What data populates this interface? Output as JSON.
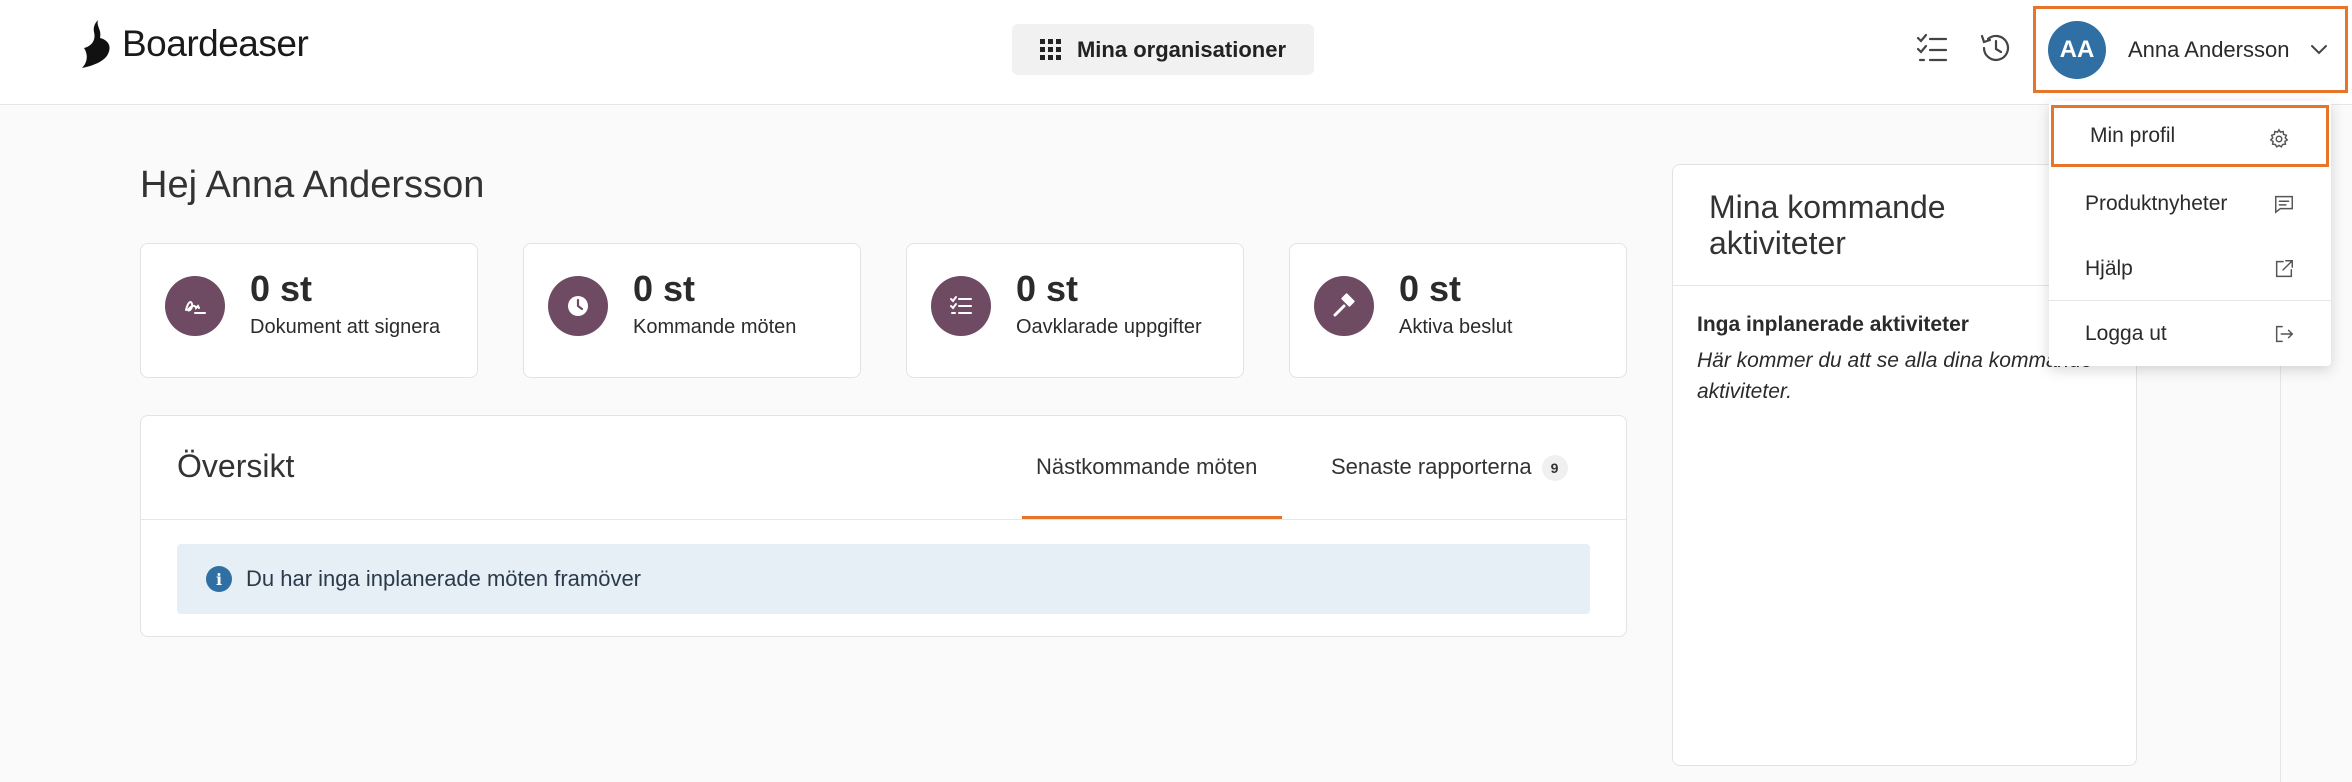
{
  "header": {
    "logo_text": "Boardeaser",
    "org_button_label": "Mina organisationer",
    "user": {
      "initials": "AA",
      "name": "Anna Andersson"
    }
  },
  "greeting": "Hej Anna Andersson",
  "stats": [
    {
      "value": "0 st",
      "label": "Dokument att signera",
      "icon": "signature-icon"
    },
    {
      "value": "0 st",
      "label": "Kommande möten",
      "icon": "clock-icon"
    },
    {
      "value": "0 st",
      "label": "Oavklarade uppgifter",
      "icon": "checklist-icon"
    },
    {
      "value": "0 st",
      "label": "Aktiva beslut",
      "icon": "gavel-icon"
    }
  ],
  "overview": {
    "title": "Översikt",
    "tabs": [
      {
        "label": "Nästkommande möten",
        "active": true
      },
      {
        "label": "Senaste rapporterna",
        "badge": "9"
      }
    ],
    "info_message": "Du har inga inplanerade möten framöver"
  },
  "activities": {
    "title": "Mina kommande aktiviteter",
    "empty_title": "Inga inplanerade aktiviteter",
    "empty_text": "Här kommer du att se alla dina kommande aktiviteter."
  },
  "user_menu": {
    "items": [
      {
        "label": "Min profil",
        "icon": "gear-icon"
      },
      {
        "label": "Produktnyheter",
        "icon": "message-icon"
      },
      {
        "label": "Hjälp",
        "icon": "external-link-icon"
      },
      {
        "label": "Logga ut",
        "icon": "logout-icon"
      }
    ]
  },
  "colors": {
    "accent": "#e8742a",
    "stat_icon_bg": "#6e4a63",
    "avatar_bg": "#2f6fa3",
    "info_bg": "#e6eff6"
  }
}
